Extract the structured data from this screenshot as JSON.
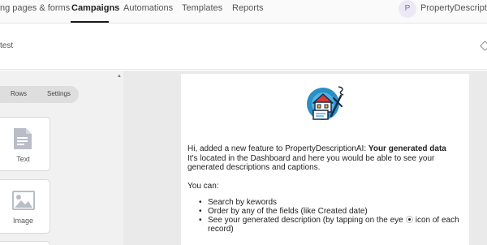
{
  "nav": {
    "tabs": [
      {
        "label": "ng pages & forms"
      },
      {
        "label": "Campaigns"
      },
      {
        "label": "Automations"
      },
      {
        "label": "Templates"
      },
      {
        "label": "Reports"
      }
    ],
    "avatar_initial": "P",
    "account_name": "PropertyDescription"
  },
  "subheader": {
    "campaign_name": "test"
  },
  "left_panel": {
    "tabs": [
      {
        "label": "Rows"
      },
      {
        "label": "Settings"
      }
    ],
    "blocks": [
      {
        "label": "Text",
        "icon": "text-document-icon"
      },
      {
        "label": "Image",
        "icon": "image-icon"
      }
    ]
  },
  "email": {
    "greeting_prefix": "Hi, added a new feature to PropertyDescriptionAI: ",
    "greeting_bold": "Your generated data",
    "paragraph": "It's located in the Dashboard and here you would be able to see your generated descriptions and captions.",
    "you_can": "You can:",
    "bullets": {
      "item1": "Search by kewords",
      "item2": "Order by any of the fields (like Created date)",
      "item3_before": "See your generated description (by tapping on the eye",
      "item3_after": "icon of each record)"
    }
  },
  "colors": {
    "accent": "#1a1a1a",
    "canvas": "#eaeaea",
    "panel": "#f1f1f1"
  }
}
